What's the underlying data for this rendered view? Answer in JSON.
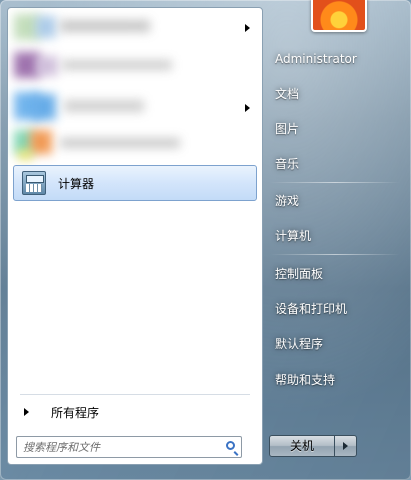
{
  "pinned_items": [
    {
      "label": "",
      "has_submenu": true
    },
    {
      "label": "",
      "has_submenu": false
    },
    {
      "label": "",
      "has_submenu": true
    },
    {
      "label": "",
      "has_submenu": false
    }
  ],
  "recent_items": [
    {
      "label": "计算器",
      "icon": "calculator-icon"
    }
  ],
  "all_programs_label": "所有程序",
  "search": {
    "placeholder": "搜索程序和文件"
  },
  "user": {
    "name": "Administrator"
  },
  "right_links": [
    {
      "label": "文档"
    },
    {
      "label": "图片"
    },
    {
      "label": "音乐"
    },
    {
      "label": "游戏"
    },
    {
      "label": "计算机"
    },
    {
      "label": "控制面板"
    },
    {
      "label": "设备和打印机"
    },
    {
      "label": "默认程序"
    },
    {
      "label": "帮助和支持"
    }
  ],
  "shutdown_label": "关机",
  "colors": {
    "selection": "#c3dbf7",
    "pane": "#ffffff",
    "accent": "#3b73c4"
  }
}
